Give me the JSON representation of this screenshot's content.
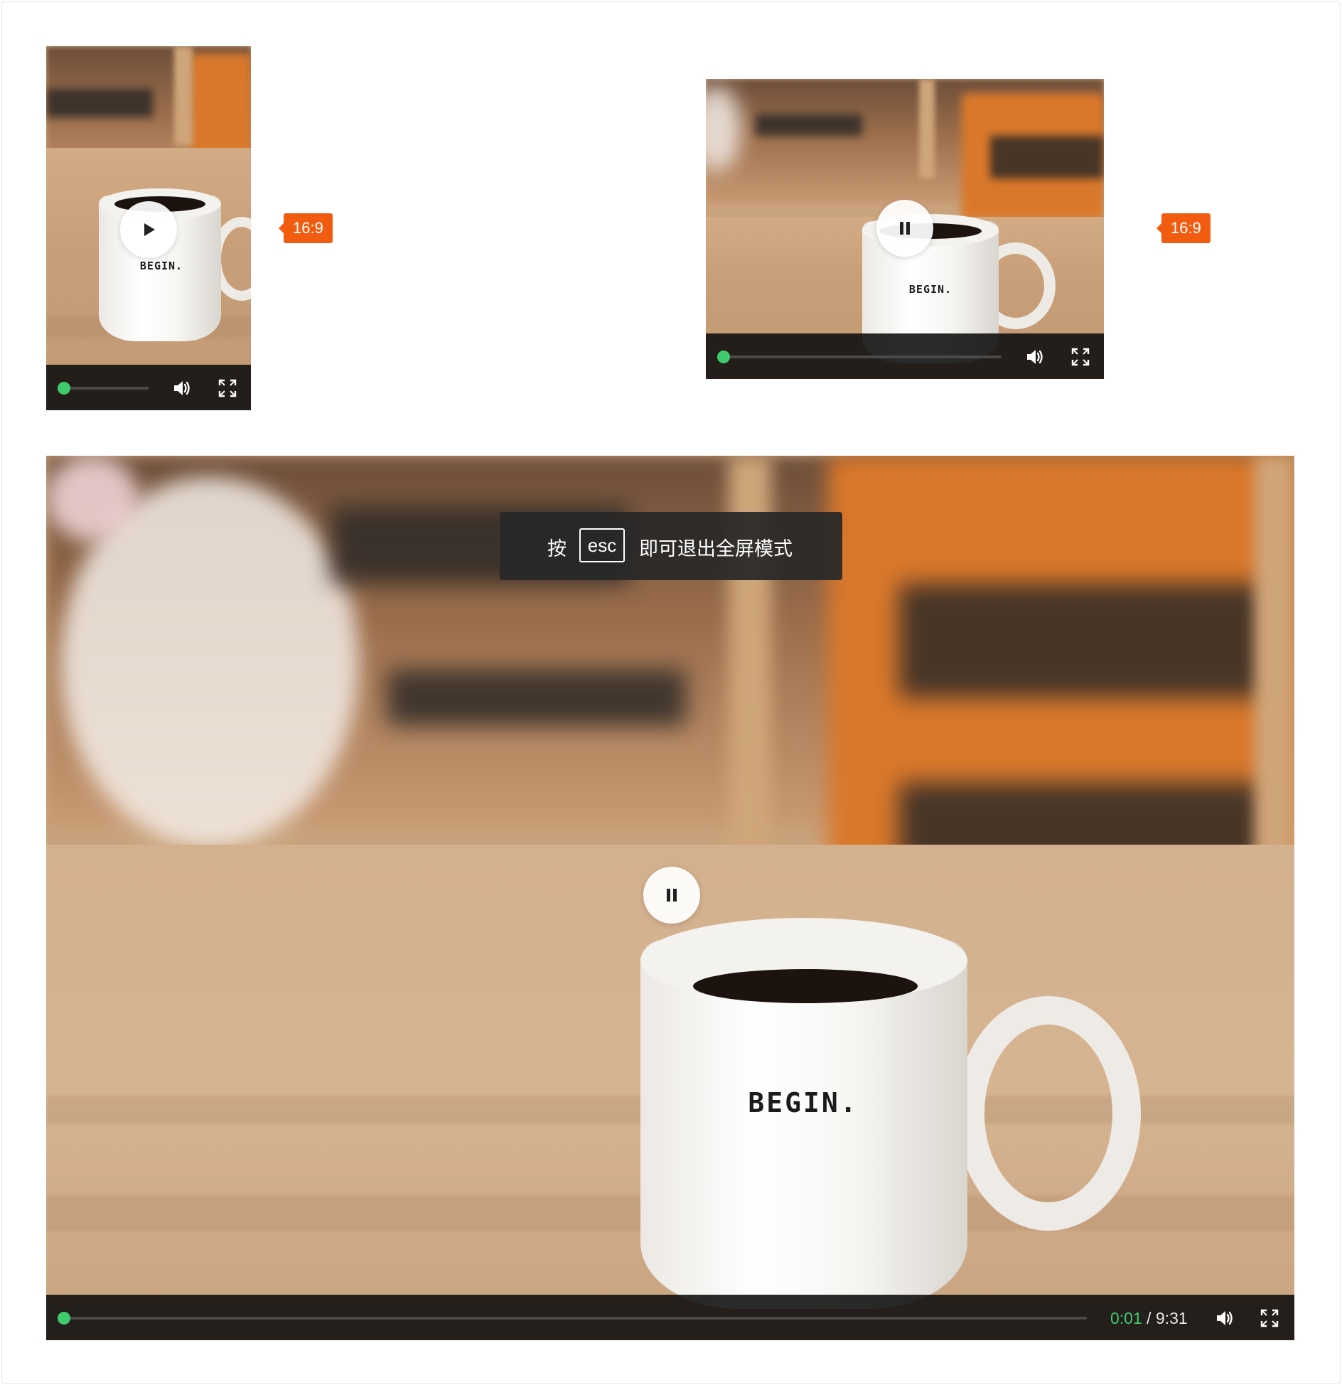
{
  "players": {
    "portrait": {
      "ratio_tag": "16:9",
      "state": "paused",
      "center_button": "play-icon",
      "progress": 0.0
    },
    "landscape": {
      "ratio_tag": "16:9",
      "state": "playing",
      "center_button": "pause-icon",
      "progress": 0.0
    },
    "fullscreen": {
      "state": "playing",
      "center_button": "pause-icon",
      "progress": 0.0,
      "time_current": "0:01",
      "time_separator": "/",
      "time_total": "9:31",
      "esc_hint": {
        "before": "按",
        "key": "esc",
        "after": "即可退出全屏模式"
      }
    }
  },
  "mug_text": "BEGIN.",
  "colors": {
    "accent_green": "#3fca6d",
    "tag_orange": "#f25c10",
    "control_bar": "#0c0c0c"
  },
  "icons": [
    "play-icon",
    "pause-icon",
    "volume-icon",
    "fullscreen-icon"
  ]
}
